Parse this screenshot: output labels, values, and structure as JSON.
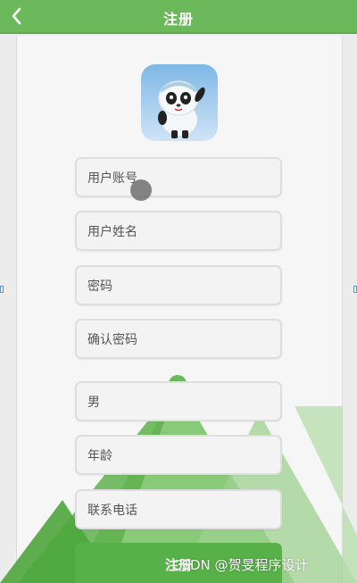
{
  "header": {
    "title": "注册",
    "back_icon": "chevron-left-icon"
  },
  "logo": {
    "icon": "panda-mascot-icon"
  },
  "form": {
    "account_placeholder": "用户账号",
    "name_placeholder": "用户姓名",
    "password_placeholder": "密码",
    "confirm_password_placeholder": "确认密码",
    "gender_value": "男",
    "age_placeholder": "年龄",
    "phone_placeholder": "联系电话",
    "submit_label": "注册"
  },
  "watermark": "CSDN @贺旻程序设计",
  "colors": {
    "primary": "#6bb95a",
    "button": "#58b048",
    "background": "#f6f6f6"
  }
}
